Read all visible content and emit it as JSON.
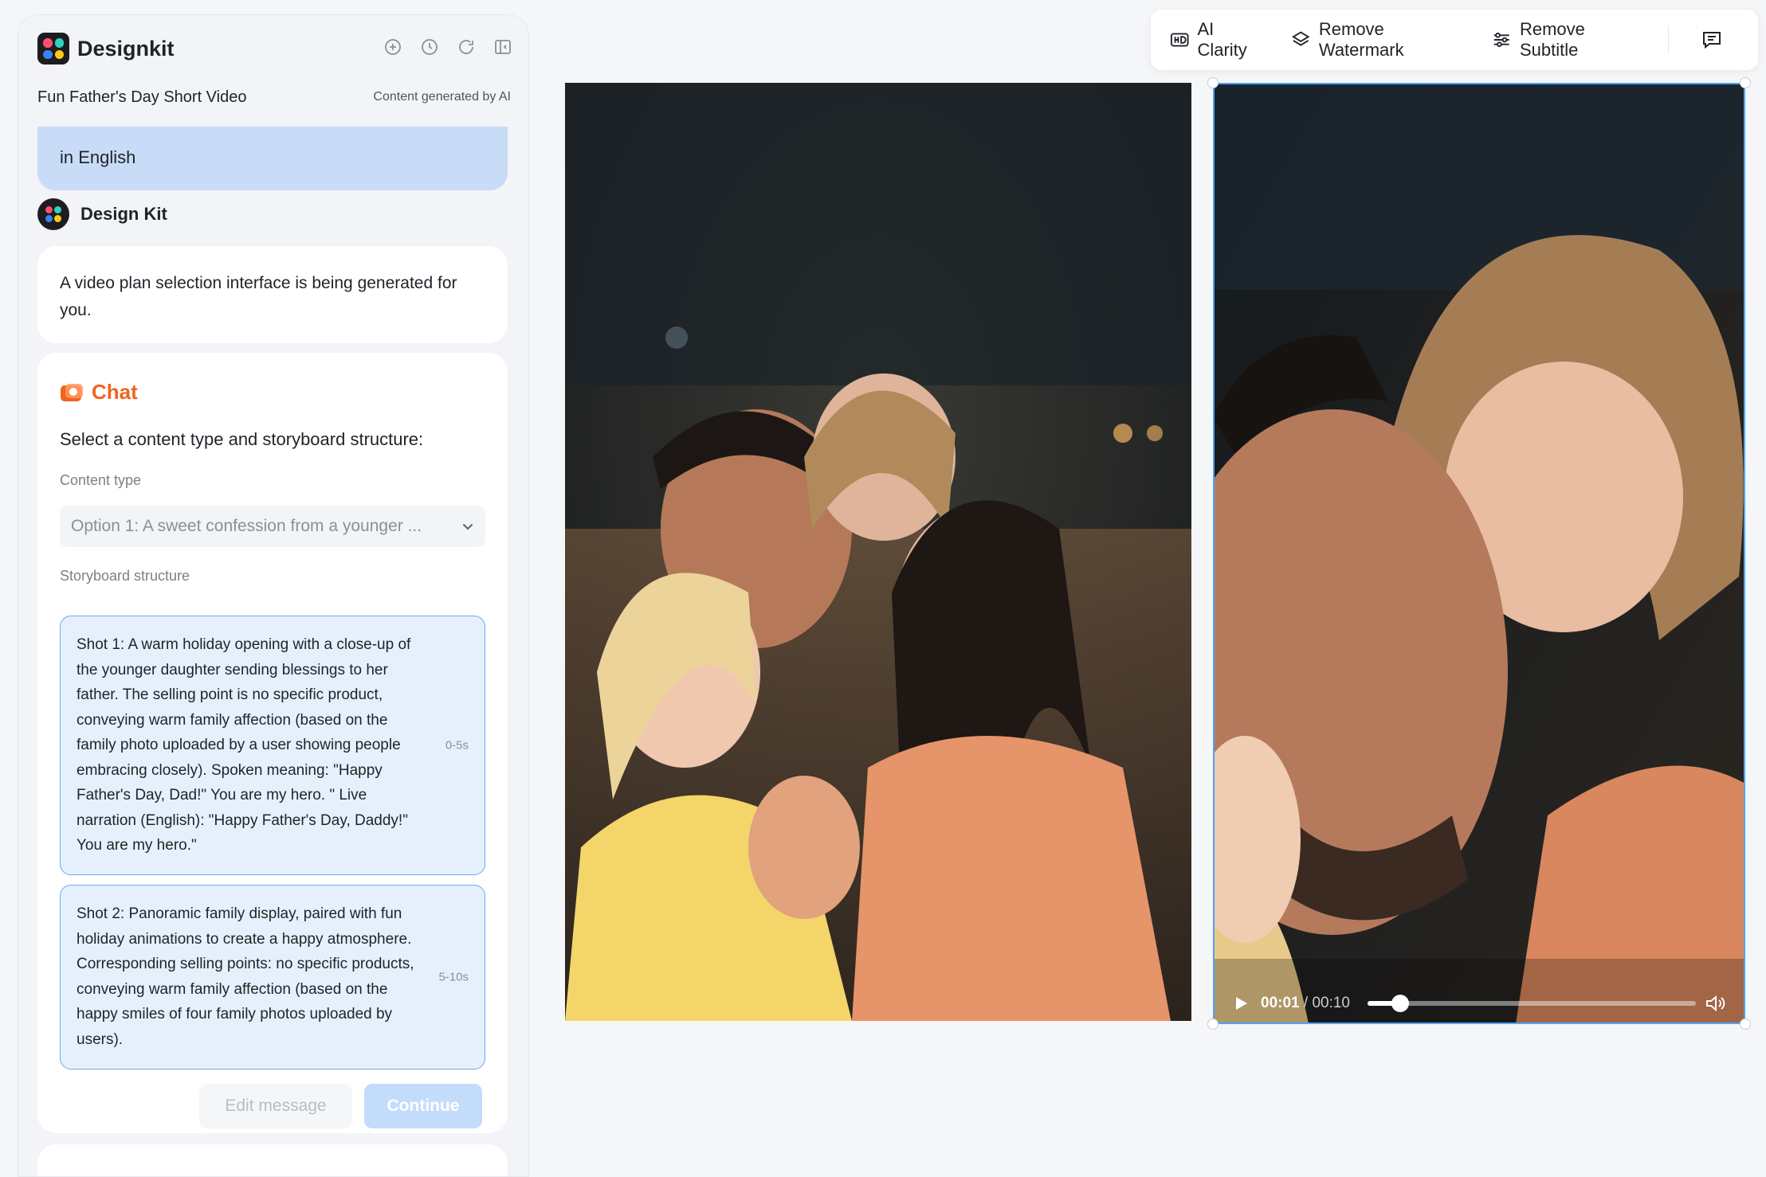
{
  "app": {
    "name": "Designkit",
    "project_title": "Fun Father's Day Short Video",
    "ai_note": "Content generated by AI"
  },
  "conversation": {
    "user_message_tail": "in English",
    "bot_name": "Design Kit",
    "bot_message": "A video plan selection interface is being generated for you.",
    "chat_card": {
      "title": "Chat",
      "prompt": "Select a content type and storyboard structure:",
      "content_type_label": "Content type",
      "content_type_value": "Option 1: A sweet confession from a younger ...",
      "storyboard_label": "Storyboard structure",
      "shots": [
        {
          "text": "Shot 1: A warm holiday opening with a close-up of the younger daughter sending blessings to her father. The selling point is no specific product, conveying warm family affection (based on the family photo uploaded by a user showing people embracing closely). Spoken meaning: \"Happy Father's Day, Dad!\" You are my hero. \" Live narration (English): \"Happy Father's Day, Daddy!\" You are my hero.\"",
          "duration": "0-5s"
        },
        {
          "text": "Shot 2: Panoramic family display, paired with fun holiday animations to create a happy atmosphere. Corresponding selling points: no specific products, conveying warm family affection (based on the happy smiles of four family photos uploaded by users).",
          "duration": "5-10s"
        }
      ],
      "edit_button": "Edit message",
      "continue_button": "Continue"
    }
  },
  "toolbar": {
    "ai_clarity": "AI Clarity",
    "remove_watermark": "Remove Watermark",
    "remove_subtitle": "Remove Subtitle"
  },
  "player": {
    "current_time": "00:01",
    "total_time": "/ 00:10",
    "progress": 0.1
  },
  "colors": {
    "accent_blue": "#4fa3f7",
    "chat_orange": "#f0641e",
    "bubble_blue": "#c9dcf7",
    "shot_bg": "#e6f0fc"
  }
}
